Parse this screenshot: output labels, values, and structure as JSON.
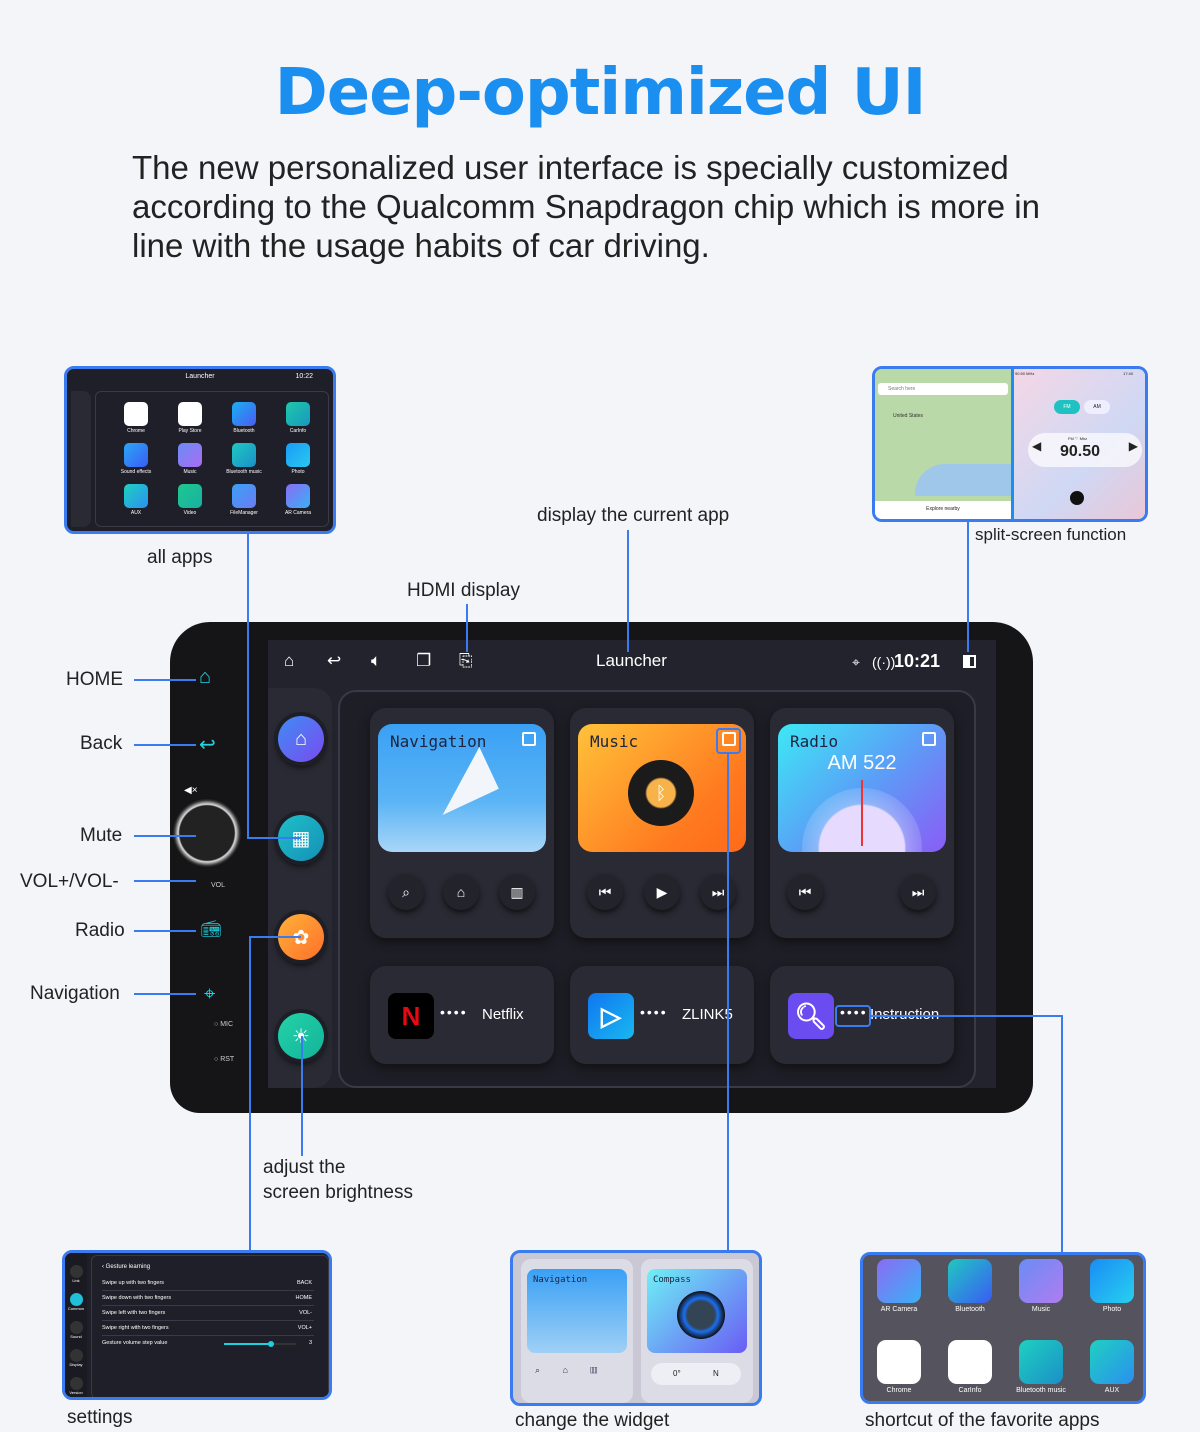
{
  "header": {
    "title": "Deep-optimized UI",
    "description": "The new personalized user interface is specially customized according to the Qualcomm Snapdragon chip which is more in line with the usage habits of car driving."
  },
  "colors": {
    "accent": "#1b8ff0",
    "callout_line": "#3a7bf0",
    "hardware_icon": "#22d3df"
  },
  "callouts": {
    "all_apps": "all apps",
    "display_current_app": "display the current app",
    "hdmi_display": "HDMI display",
    "split_screen": "split-screen function",
    "home": "HOME",
    "back": "Back",
    "mute": "Mute",
    "vol": "VOL+/VOL-",
    "radio": "Radio",
    "navigation": "Navigation",
    "brightness": "adjust the\nscreen brightness",
    "settings": "settings",
    "change_widget": "change the widget",
    "shortcut": "shortcut of the favorite apps"
  },
  "device": {
    "vol_label": "VOL",
    "mic_label": "MIC",
    "rst_label": "RST"
  },
  "status_bar": {
    "title": "Launcher",
    "time": "10:21",
    "icons": [
      "home-icon",
      "back-icon",
      "volume-icon",
      "recent-apps-icon",
      "hdmi-icon",
      "location-icon",
      "hotspot-icon",
      "split-screen-icon"
    ]
  },
  "widgets": [
    {
      "title": "Navigation",
      "buttons": [
        "search-icon",
        "home-icon",
        "building-icon"
      ]
    },
    {
      "title": "Music",
      "buttons": [
        "previous-icon",
        "play-icon",
        "next-icon"
      ]
    },
    {
      "title": "Radio",
      "value": "AM 522",
      "buttons": [
        "previous-icon",
        "next-icon"
      ]
    }
  ],
  "apps": [
    {
      "name": "Netflix",
      "dots": "••••"
    },
    {
      "name": "ZLINK5",
      "dots": "••••"
    },
    {
      "name": "Instruction",
      "dots": "••••"
    }
  ],
  "all_apps_thumb": {
    "title": "Launcher",
    "time": "10:22",
    "apps": [
      "Chrome",
      "Play Store",
      "Bluetooth",
      "CarInfo",
      "Sound effects",
      "Music",
      "Bluetooth music",
      "Photo",
      "AUX",
      "Video",
      "FileManager",
      "AR Camera"
    ]
  },
  "split_thumb": {
    "search_placeholder": "Search here",
    "map_country": "United States",
    "explore": "Explore nearby",
    "freq_top": "90.50 MHz",
    "time": "17:40",
    "band_fm": "FM",
    "band_am": "AM",
    "freq_sub": "FM ♡ Mhz",
    "frequency": "90.50"
  },
  "settings_thumb": {
    "header": "Gesture learning",
    "nav": [
      "Link",
      "Common",
      "Sound",
      "Display",
      "Version"
    ],
    "rows": [
      {
        "label": "Swipe up with two fingers",
        "value": "BACK"
      },
      {
        "label": "Swipe down with two fingers",
        "value": "HOME"
      },
      {
        "label": "Swipe left with two fingers",
        "value": "VOL-"
      },
      {
        "label": "Swipe right with two fingers",
        "value": "VOL+"
      }
    ],
    "slider_label": "Gesture volume step value",
    "slider_value": "3",
    "slider_fraction": 0.65
  },
  "widget_thumb": {
    "nav_title": "Navigation",
    "compass_title": "Compass",
    "degrees": "0°",
    "direction": "N"
  },
  "fav_thumb": {
    "apps": [
      "AR Camera",
      "Bluetooth",
      "Music",
      "Photo",
      "Chrome",
      "CarInfo",
      "Bluetooth music",
      "AUX"
    ]
  }
}
